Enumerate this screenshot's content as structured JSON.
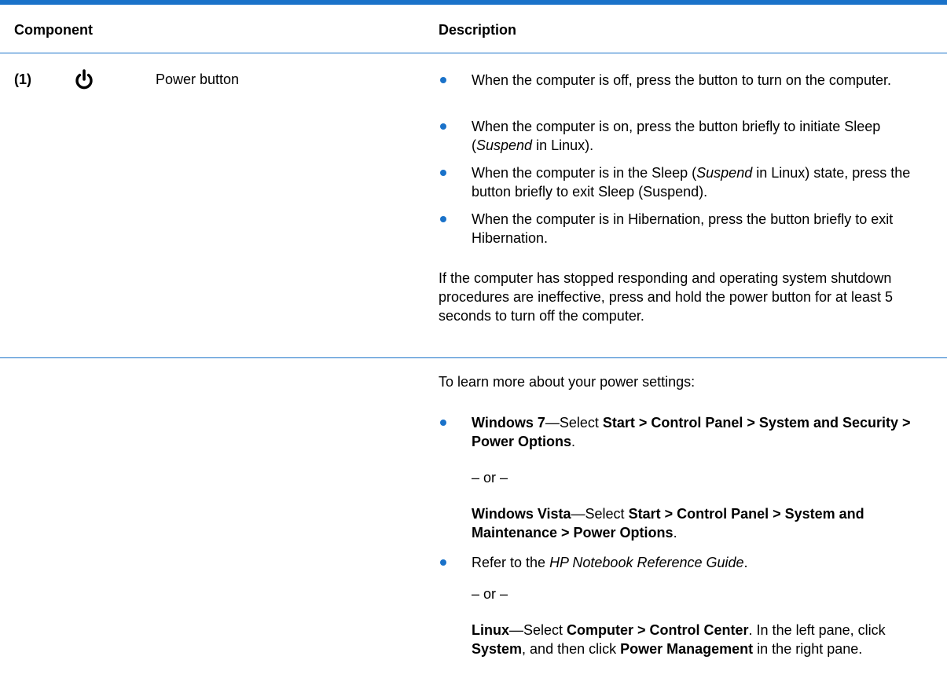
{
  "header": {
    "component": "Component",
    "description": "Description"
  },
  "row": {
    "number": "(1)",
    "icon": "power-icon",
    "name": "Power button"
  },
  "bullets_power": [
    {
      "text": "When the computer is off, press the button to turn on the computer."
    },
    {
      "pre": "When the computer is on, press the button briefly to initiate Sleep (",
      "italic": "Suspend",
      "post": " in Linux)."
    },
    {
      "pre": "When the computer is in the Sleep (",
      "italic": "Suspend",
      "post": " in Linux) state, press the button briefly to exit Sleep (Suspend)."
    },
    {
      "text": "When the computer is in Hibernation, press the button briefly to exit Hibernation."
    }
  ],
  "hold_note": "If the computer has stopped responding and operating system shutdown procedures are ineffective, press and hold the power button for at least 5 seconds to turn off the computer.",
  "learn_more": {
    "intro": "To learn more about your power settings:",
    "win7": {
      "os": "Windows 7",
      "select": "—Select ",
      "path": "Start > Control Panel > System and Security > Power Options",
      "end": "."
    },
    "or1": "– or –",
    "vista": {
      "os": "Windows Vista",
      "select": "—Select ",
      "path": "Start > Control Panel > System and Maintenance > Power Options",
      "end": "."
    },
    "refer": {
      "pre": "Refer to the ",
      "italic": "HP Notebook Reference Guide",
      "post": "."
    },
    "or2": "– or –",
    "linux": {
      "os": "Linux",
      "select": "—Select ",
      "path": "Computer > Control Center",
      "mid1": ".  In the left pane, click ",
      "system": "System",
      "mid2": ", and then click ",
      "pm": "Power Management",
      "end": " in the right pane."
    }
  },
  "colors": {
    "accent": "#1a72c9"
  }
}
